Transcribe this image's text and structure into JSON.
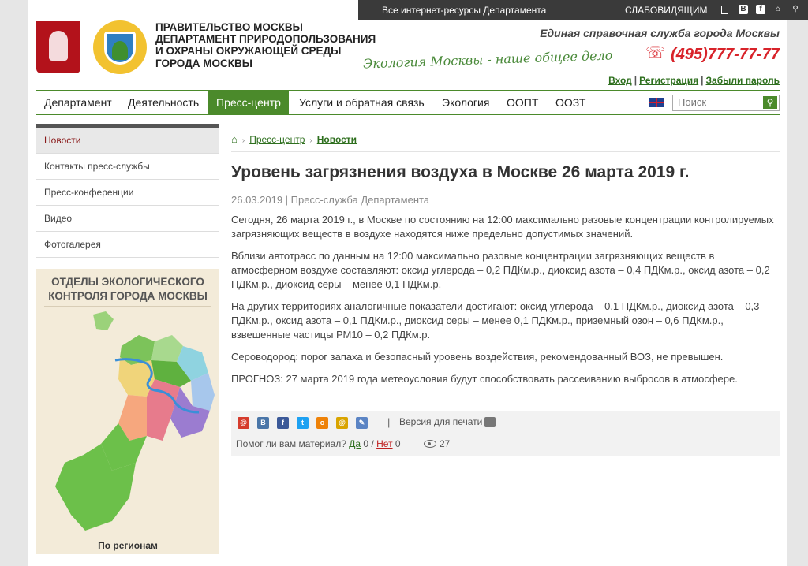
{
  "topbar": {
    "all_resources": "Все интернет-ресурсы Департамента",
    "visually_impaired": "СЛАБОВИДЯЩИМ",
    "icons": [
      "mobile-icon",
      "vk-icon",
      "facebook-icon",
      "home-icon",
      "search-icon"
    ]
  },
  "header": {
    "gov_line1": "ПРАВИТЕЛЬСТВО МОСКВЫ",
    "gov_line2": "ДЕПАРТАМЕНТ ПРИРОДОПОЛЬЗОВАНИЯ",
    "gov_line3": "И ОХРАНЫ ОКРУЖАЮЩЕЙ СРЕДЫ",
    "gov_line4": "ГОРОДА МОСКВЫ",
    "slogan": "Экология Москвы - наше общее дело",
    "helpline_label": "Единая справочная служба города Москвы",
    "phone": "(495)777-77-77",
    "auth": {
      "login": "Вход",
      "register": "Регистрация",
      "forgot": "Забыли пароль"
    }
  },
  "nav": {
    "items": [
      "Департамент",
      "Деятельность",
      "Пресс-центр",
      "Услуги и обратная связь",
      "Экология",
      "ООПТ",
      "ООЗТ"
    ],
    "active_index": 2,
    "search_placeholder": "Поиск"
  },
  "sidebar": {
    "items": [
      "Новости",
      "Контакты пресс-службы",
      "Пресс-конференции",
      "Видео",
      "Фотогалерея"
    ],
    "active_index": 0,
    "map_title_line1": "ОТДЕЛЫ ЭКОЛОГИЧЕСКОГО",
    "map_title_line2": "КОНТРОЛЯ ГОРОДА МОСКВЫ",
    "map_button": "По регионам"
  },
  "breadcrumb": {
    "level1": "Пресс-центр",
    "level2": "Новости"
  },
  "article": {
    "title": "Уровень загрязнения воздуха в Москве 26 марта 2019 г.",
    "meta": "26.03.2019 | Пресс-служба Департамента",
    "paragraphs": [
      "Сегодня, 26 марта 2019 г., в Москве по состоянию на 12:00 максимально разовые концентрации контролируемых загрязняющих веществ в воздухе находятся ниже предельно допустимых значений.",
      "Вблизи автотрасс по данным на 12:00 максимально разовые концентрации загрязняющих веществ в атмосферном воздухе составляют: оксид углерода – 0,2 ПДКм.р., диоксид азота – 0,4 ПДКм.р., оксид азота – 0,2 ПДКм.р., диоксид серы – менее 0,1 ПДКм.р.",
      "На других территориях аналогичные показатели достигают: оксид углерода – 0,1 ПДКм.р., диоксид азота – 0,3 ПДКм.р., оксид азота – 0,1 ПДКм.р., диоксид  серы – менее 0,1 ПДКм.р., приземный озон – 0,6 ПДКм.р., взвешенные частицы РМ10 – 0,2 ПДКм.р.",
      "Сероводород: порог запаха и безопасный уровень воздействия, рекомендованный ВОЗ, не превышен.",
      "ПРОГНОЗ: 27 марта 2019 года метеоусловия будут способствовать рассеиванию выбросов в атмосфере."
    ]
  },
  "share": {
    "print_label": "Версия для печати",
    "helpful_question": "Помог ли вам материал?",
    "yes_label": "Да",
    "yes_count": "0",
    "no_label": "Нет",
    "no_count": "0",
    "views": "27",
    "icons": [
      {
        "name": "mailru-icon",
        "color": "#d53c2d"
      },
      {
        "name": "vk-icon",
        "color": "#4a76a8"
      },
      {
        "name": "facebook-icon",
        "color": "#3b5998"
      },
      {
        "name": "twitter-icon",
        "color": "#1da1f2"
      },
      {
        "name": "odnoklassniki-icon",
        "color": "#ee8208"
      },
      {
        "name": "livejournal-icon",
        "color": "#d9a400"
      },
      {
        "name": "email-icon",
        "color": "#5b84c4"
      }
    ]
  },
  "colors": {
    "brand_green": "#4b8a2b",
    "accent_red": "#d8232a"
  }
}
